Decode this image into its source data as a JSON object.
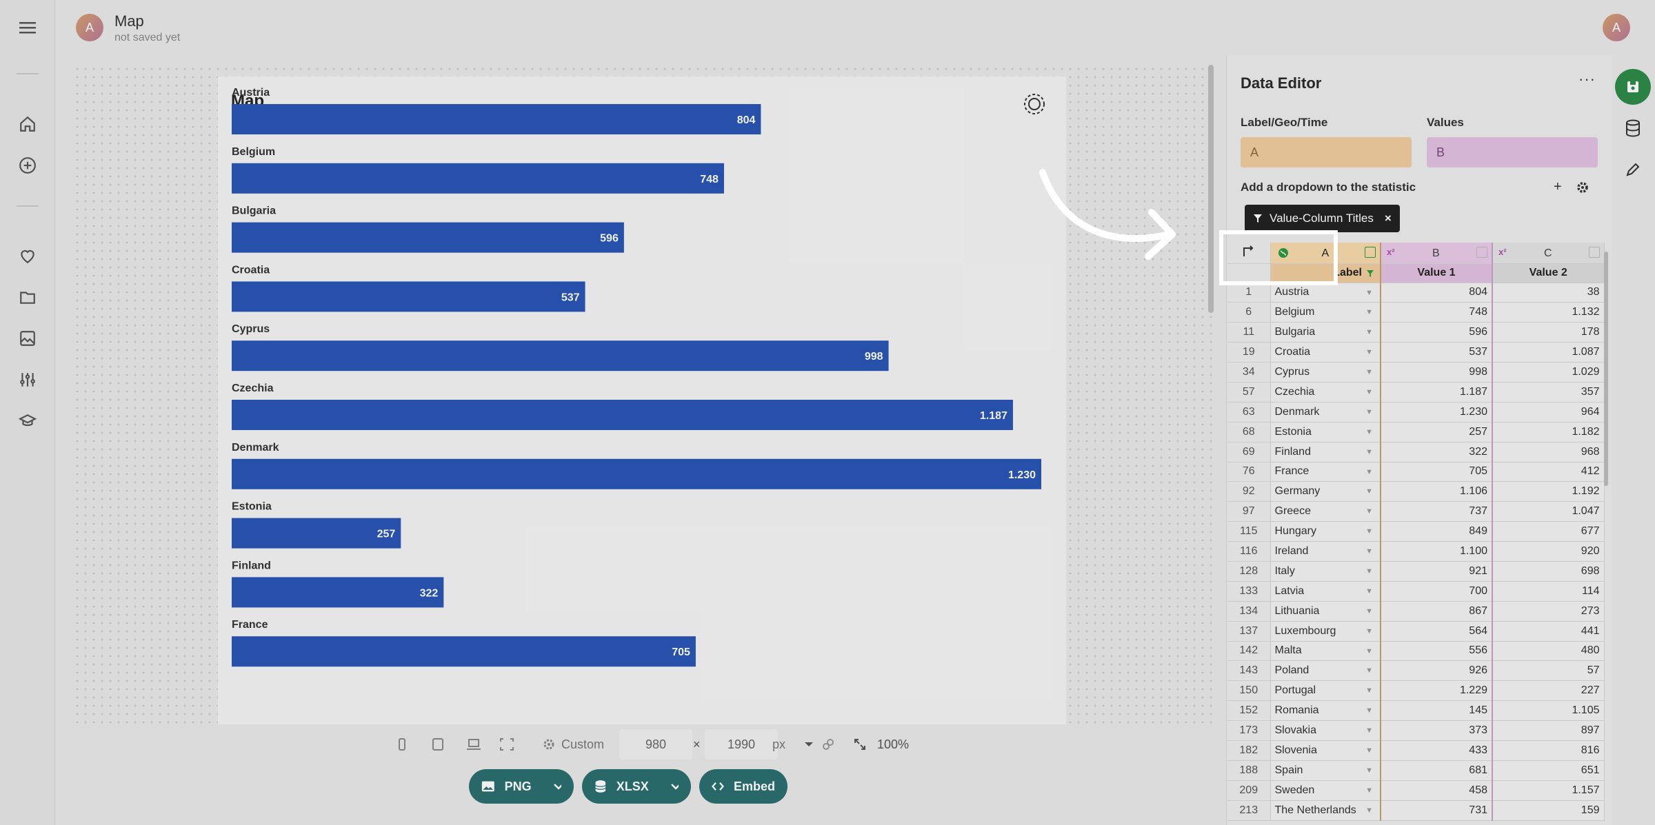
{
  "header": {
    "avatar_letter": "A",
    "title": "Map",
    "subtitle": "not saved yet",
    "user_avatar_letter": "A"
  },
  "rail": {
    "icons": [
      "menu-icon",
      "home-icon",
      "add-circle-icon",
      "heart-icon",
      "folder-icon",
      "image-icon",
      "sliders-icon",
      "graduation-cap-icon"
    ]
  },
  "toolbar": {
    "preset_label": "Custom",
    "width_value": "980",
    "times": "×",
    "height_value": "1990",
    "unit": "px",
    "zoom": "100%",
    "export_png": "PNG",
    "export_xlsx": "XLSX",
    "embed": "Embed"
  },
  "editor": {
    "title": "Data Editor",
    "more": "···",
    "label_geo_time": "Label/Geo/Time",
    "values_label": "Values",
    "label_pick": "A",
    "values_pick": "B",
    "dropdown_label": "Add a dropdown to the statistic",
    "plus": "+",
    "chip_label": "Value-Column Titles",
    "chip_close": "×",
    "colA": "A",
    "colB": "B",
    "colC": "C",
    "colA_title": "Label",
    "colB_title": "Value 1",
    "colC_title": "Value 2",
    "x2": "x²",
    "rows": [
      {
        "n": "1",
        "label": "Austria",
        "v1": "804",
        "v2": "38"
      },
      {
        "n": "6",
        "label": "Belgium",
        "v1": "748",
        "v2": "1.132"
      },
      {
        "n": "11",
        "label": "Bulgaria",
        "v1": "596",
        "v2": "178"
      },
      {
        "n": "19",
        "label": "Croatia",
        "v1": "537",
        "v2": "1.087"
      },
      {
        "n": "34",
        "label": "Cyprus",
        "v1": "998",
        "v2": "1.029"
      },
      {
        "n": "57",
        "label": "Czechia",
        "v1": "1.187",
        "v2": "357"
      },
      {
        "n": "63",
        "label": "Denmark",
        "v1": "1.230",
        "v2": "964"
      },
      {
        "n": "68",
        "label": "Estonia",
        "v1": "257",
        "v2": "1.182"
      },
      {
        "n": "69",
        "label": "Finland",
        "v1": "322",
        "v2": "968"
      },
      {
        "n": "76",
        "label": "France",
        "v1": "705",
        "v2": "412"
      },
      {
        "n": "92",
        "label": "Germany",
        "v1": "1.106",
        "v2": "1.192"
      },
      {
        "n": "97",
        "label": "Greece",
        "v1": "737",
        "v2": "1.047"
      },
      {
        "n": "115",
        "label": "Hungary",
        "v1": "849",
        "v2": "677"
      },
      {
        "n": "116",
        "label": "Ireland",
        "v1": "1.100",
        "v2": "920"
      },
      {
        "n": "128",
        "label": "Italy",
        "v1": "921",
        "v2": "698"
      },
      {
        "n": "133",
        "label": "Latvia",
        "v1": "700",
        "v2": "114"
      },
      {
        "n": "134",
        "label": "Lithuania",
        "v1": "867",
        "v2": "273"
      },
      {
        "n": "137",
        "label": "Luxembourg",
        "v1": "564",
        "v2": "441"
      },
      {
        "n": "142",
        "label": "Malta",
        "v1": "556",
        "v2": "480"
      },
      {
        "n": "143",
        "label": "Poland",
        "v1": "926",
        "v2": "57"
      },
      {
        "n": "150",
        "label": "Portugal",
        "v1": "1.229",
        "v2": "227"
      },
      {
        "n": "152",
        "label": "Romania",
        "v1": "145",
        "v2": "1.105"
      },
      {
        "n": "173",
        "label": "Slovakia",
        "v1": "373",
        "v2": "897"
      },
      {
        "n": "182",
        "label": "Slovenia",
        "v1": "433",
        "v2": "816"
      },
      {
        "n": "188",
        "label": "Spain",
        "v1": "681",
        "v2": "651"
      },
      {
        "n": "209",
        "label": "Sweden",
        "v1": "458",
        "v2": "1.157"
      },
      {
        "n": "213",
        "label": "The Netherlands",
        "v1": "731",
        "v2": "159"
      }
    ]
  },
  "colors": {
    "bar": "#2a55b5",
    "accent": "#2b6f6f",
    "colA": "#f0cda0",
    "colB": "#e2c2e2"
  },
  "chart_data": {
    "type": "bar",
    "title": "Map",
    "orientation": "horizontal",
    "categories": [
      "Austria",
      "Belgium",
      "Bulgaria",
      "Croatia",
      "Cyprus",
      "Czechia",
      "Denmark",
      "Estonia",
      "Finland",
      "France"
    ],
    "values": [
      804,
      748,
      596,
      537,
      998,
      1187,
      1230,
      257,
      322,
      705
    ],
    "value_labels": [
      "804",
      "748",
      "596",
      "537",
      "998",
      "1.187",
      "1.230",
      "257",
      "322",
      "705"
    ],
    "xlim": [
      0,
      1230
    ]
  }
}
